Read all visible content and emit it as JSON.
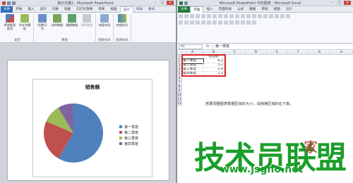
{
  "ppt": {
    "title": "演示文稿1 - Microsoft PowerPoint",
    "tabs": [
      "文件",
      "开始",
      "插入",
      "设计",
      "切换",
      "动画",
      "幻灯片放映",
      "审阅",
      "视图",
      "设计",
      "布局",
      "格式"
    ],
    "ribbon_groups": [
      {
        "label": "类型",
        "buttons": [
          "更改图表类型",
          "另存为模板"
        ]
      },
      {
        "label": "数据",
        "buttons": [
          "切换行/列",
          "选择数据",
          "编辑数据",
          "刷新数据"
        ]
      },
      {
        "label": "图表布局",
        "buttons": [
          "快速布局"
        ]
      },
      {
        "label": "图表样式",
        "buttons": [
          "快速样式"
        ]
      }
    ],
    "chart": {
      "title": "销售额",
      "legend": [
        "第一季度",
        "第二季度",
        "第三季度",
        "第四季度"
      ]
    }
  },
  "excel": {
    "title": "Microsoft PowerPoint 中的图表 - Microsoft Excel",
    "tabs": [
      "文件",
      "开始",
      "插入",
      "页面布局",
      "公式",
      "数据",
      "审阅",
      "视图",
      "设计"
    ],
    "name_box": "A1",
    "formula_value": "第一季度",
    "columns": [
      "A",
      "B",
      "C",
      "D",
      "E",
      "F",
      "G",
      "H"
    ],
    "rows": [
      "1",
      "2",
      "3",
      "4",
      "5",
      "6",
      "7",
      "8",
      "9",
      "10",
      "11",
      "12"
    ],
    "table": [
      [
        "",
        "销售额"
      ],
      [
        "第一季度",
        "8.2"
      ],
      [
        "第二季度",
        "3.2"
      ],
      [
        "第三季度",
        "1.4"
      ],
      [
        "第四季度",
        "1.2"
      ]
    ],
    "instruction": "若要调整图表数据区域的大小，请拖拽区域的右下角。"
  },
  "chart_data": {
    "type": "pie",
    "title": "销售额",
    "categories": [
      "第一季度",
      "第二季度",
      "第三季度",
      "第四季度"
    ],
    "values": [
      8.2,
      3.2,
      1.4,
      1.2
    ],
    "colors": [
      "#4f81bd",
      "#c0504d",
      "#9bbb59",
      "#8064a2"
    ],
    "legend_position": "right"
  },
  "watermark": {
    "main": "技术员联盟",
    "side": "家",
    "url": "www.jsgho.net"
  }
}
